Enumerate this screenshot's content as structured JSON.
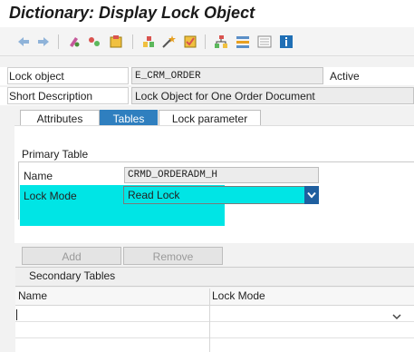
{
  "window": {
    "title": "Dictionary: Display Lock Object"
  },
  "toolbar": {
    "icons": [
      "back-icon",
      "forward-icon",
      "display-change-icon",
      "active-inactive-icon",
      "other-object-icon",
      "where-used-icon",
      "magic-wand-icon",
      "check-icon",
      "hierarchy-icon",
      "object-list-icon",
      "display-object-list-icon",
      "info-icon"
    ]
  },
  "header": {
    "lock_object_label": "Lock object",
    "lock_object_value": "E_CRM_ORDER",
    "status": "Active",
    "short_desc_label": "Short Description",
    "short_desc_value": "Lock Object for One Order Document"
  },
  "tabs": [
    {
      "label": "Attributes",
      "active": false
    },
    {
      "label": "Tables",
      "active": true
    },
    {
      "label": "Lock parameter",
      "active": false
    }
  ],
  "primary": {
    "title": "Primary Table",
    "name_label": "Name",
    "name_value": "CRMD_ORDERADM_H",
    "mode_label": "Lock Mode",
    "mode_value": "Read Lock"
  },
  "buttons": {
    "add": "Add",
    "remove": "Remove"
  },
  "secondary": {
    "title": "Secondary Tables",
    "columns": [
      "Name",
      "Lock Mode"
    ]
  },
  "colors": {
    "highlight": "#00e5e5",
    "active_tab": "#2f7fbf"
  }
}
